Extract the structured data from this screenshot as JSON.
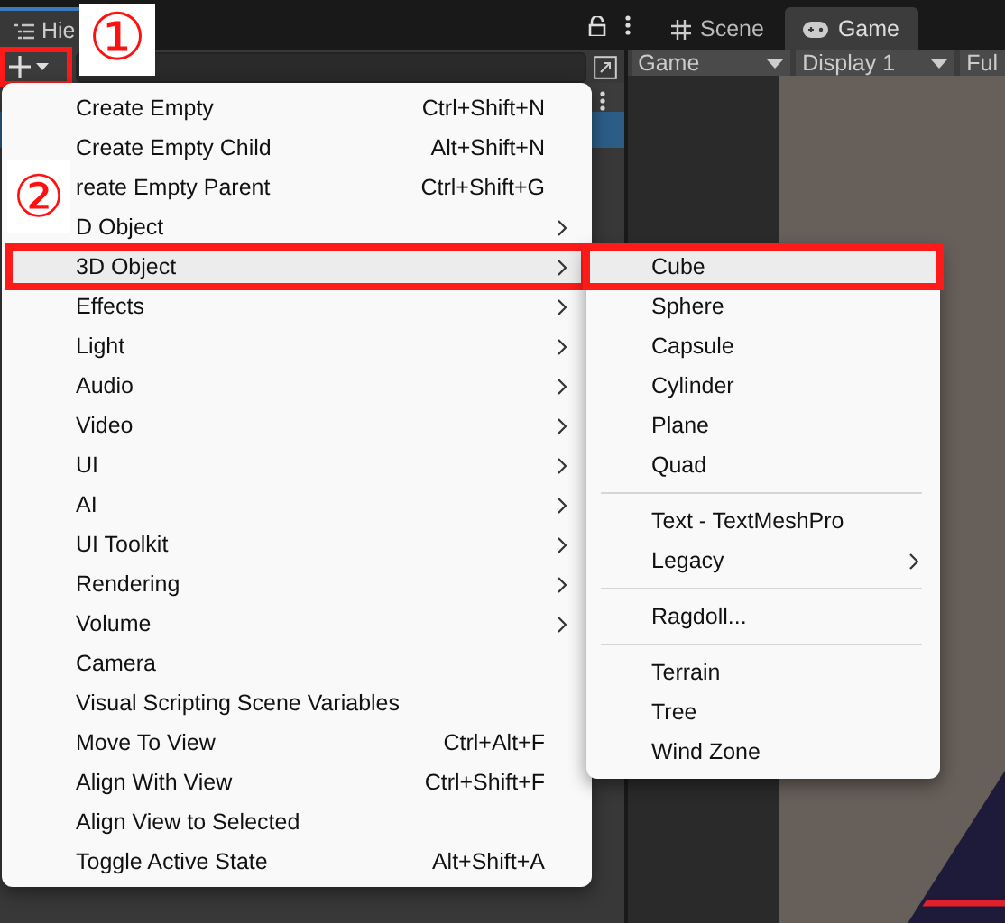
{
  "hierarchy": {
    "tab": "Hie",
    "add_button": {
      "marked": true
    }
  },
  "game_view": {
    "tabs": [
      {
        "label": "Scene",
        "selected": false
      },
      {
        "label": "Game",
        "selected": true
      }
    ],
    "toolbar": [
      "Game",
      "Display 1",
      "Ful"
    ]
  },
  "menu": {
    "items": [
      {
        "label": "Create Empty",
        "shortcut": "Ctrl+Shift+N",
        "submenu": false,
        "selected": false
      },
      {
        "label": "Create Empty Child",
        "shortcut": "Alt+Shift+N",
        "submenu": false,
        "selected": false
      },
      {
        "label": "reate Empty Parent",
        "shortcut": "Ctrl+Shift+G",
        "submenu": false,
        "selected": false
      },
      {
        "label": "D Object",
        "submenu": true,
        "selected": false
      },
      {
        "label": "3D Object",
        "submenu": true,
        "selected": true
      },
      {
        "label": "Effects",
        "submenu": true,
        "selected": false
      },
      {
        "label": "Light",
        "submenu": true,
        "selected": false
      },
      {
        "label": "Audio",
        "submenu": true,
        "selected": false
      },
      {
        "label": "Video",
        "submenu": true,
        "selected": false
      },
      {
        "label": "UI",
        "submenu": true,
        "selected": false
      },
      {
        "label": "AI",
        "submenu": true,
        "selected": false
      },
      {
        "label": "UI Toolkit",
        "submenu": true,
        "selected": false
      },
      {
        "label": "Rendering",
        "submenu": true,
        "selected": false
      },
      {
        "label": "Volume",
        "submenu": true,
        "selected": false
      },
      {
        "label": "Camera",
        "submenu": false,
        "selected": false
      },
      {
        "label": "Visual Scripting Scene Variables",
        "submenu": false,
        "selected": false
      },
      {
        "label": "Move To View",
        "shortcut": "Ctrl+Alt+F",
        "submenu": false,
        "selected": false
      },
      {
        "label": "Align With View",
        "shortcut": "Ctrl+Shift+F",
        "submenu": false,
        "selected": false
      },
      {
        "label": "Align View to Selected",
        "submenu": false,
        "selected": false
      },
      {
        "label": "Toggle Active State",
        "shortcut": "Alt+Shift+A",
        "submenu": false,
        "selected": false
      }
    ]
  },
  "submenu": {
    "items": [
      {
        "kind": "item",
        "label": "Cube",
        "submenu": false,
        "selected": true
      },
      {
        "kind": "item",
        "label": "Sphere",
        "submenu": false,
        "selected": false
      },
      {
        "kind": "item",
        "label": "Capsule",
        "submenu": false,
        "selected": false
      },
      {
        "kind": "item",
        "label": "Cylinder",
        "submenu": false,
        "selected": false
      },
      {
        "kind": "item",
        "label": "Plane",
        "submenu": false,
        "selected": false
      },
      {
        "kind": "item",
        "label": "Quad",
        "submenu": false,
        "selected": false
      },
      {
        "kind": "separator"
      },
      {
        "kind": "item",
        "label": "Text - TextMeshPro",
        "submenu": false,
        "selected": false
      },
      {
        "kind": "item",
        "label": "Legacy",
        "submenu": true,
        "selected": false
      },
      {
        "kind": "separator"
      },
      {
        "kind": "item",
        "label": "Ragdoll...",
        "submenu": false,
        "selected": false
      },
      {
        "kind": "separator"
      },
      {
        "kind": "item",
        "label": "Terrain",
        "submenu": false,
        "selected": false
      },
      {
        "kind": "item",
        "label": "Tree",
        "submenu": false,
        "selected": false
      },
      {
        "kind": "item",
        "label": "Wind Zone",
        "submenu": false,
        "selected": false
      }
    ]
  },
  "annotations": [
    {
      "label": "①"
    },
    {
      "label": "②"
    }
  ]
}
